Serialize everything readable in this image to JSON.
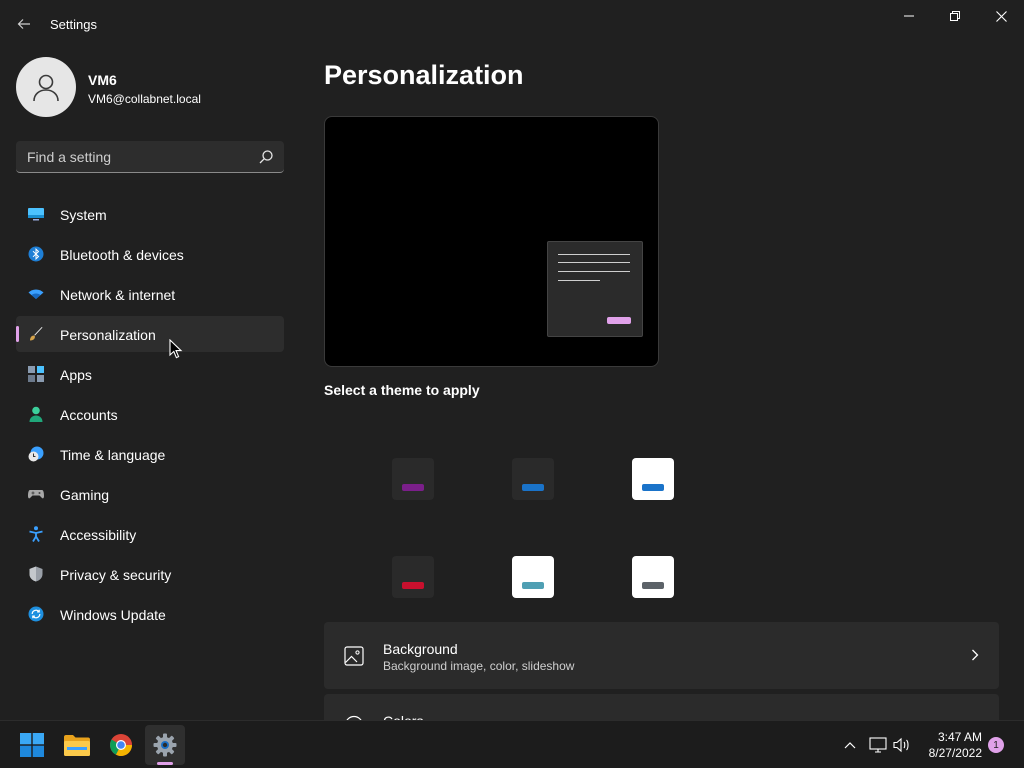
{
  "window": {
    "title": "Settings"
  },
  "user": {
    "name": "VM6",
    "email": "VM6@collabnet.local"
  },
  "search": {
    "placeholder": "Find a setting"
  },
  "nav": {
    "items": [
      {
        "label": "System",
        "icon": "monitor-icon"
      },
      {
        "label": "Bluetooth & devices",
        "icon": "bluetooth-icon"
      },
      {
        "label": "Network & internet",
        "icon": "wifi-icon"
      },
      {
        "label": "Personalization",
        "icon": "brush-icon",
        "active": true
      },
      {
        "label": "Apps",
        "icon": "apps-icon"
      },
      {
        "label": "Accounts",
        "icon": "person-icon"
      },
      {
        "label": "Time & language",
        "icon": "clock-globe-icon"
      },
      {
        "label": "Gaming",
        "icon": "gamepad-icon"
      },
      {
        "label": "Accessibility",
        "icon": "accessibility-icon"
      },
      {
        "label": "Privacy & security",
        "icon": "shield-icon"
      },
      {
        "label": "Windows Update",
        "icon": "update-icon"
      }
    ]
  },
  "main": {
    "title": "Personalization",
    "theme_heading": "Select a theme to apply",
    "themes": [
      {
        "tile": "#2a2a2a",
        "accent": "#7b1f8a"
      },
      {
        "tile": "#2a2a2a",
        "accent": "#1a73c9"
      },
      {
        "tile": "#ffffff",
        "accent": "#1a73c9"
      },
      {
        "tile": "#2a2a2a",
        "accent": "#c8102e"
      },
      {
        "tile": "#ffffff",
        "accent": "#4f9fb3"
      },
      {
        "tile": "#ffffff",
        "accent": "#5c6268"
      }
    ],
    "cards": {
      "background": {
        "title": "Background",
        "subtitle": "Background image, color, slideshow"
      },
      "colors": {
        "title": "Colors"
      }
    }
  },
  "taskbar": {
    "time": "3:47 AM",
    "date": "8/27/2022",
    "notifications": "1"
  },
  "colors": {
    "accent": "#e0a1e9",
    "background": "#202020"
  }
}
